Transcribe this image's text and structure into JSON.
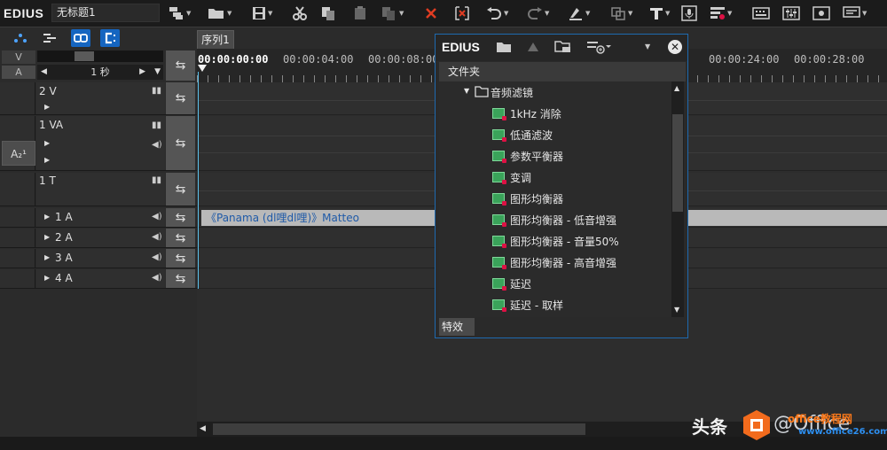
{
  "app": {
    "brand": "EDIUS",
    "project_name": "无标题1"
  },
  "toolbar": {
    "icons": [
      "new-sequence-icon",
      "open-folder-icon",
      "save-icon",
      "cut-icon",
      "copy-icon",
      "paste-icon",
      "paste-insert-icon",
      "delete-icon",
      "ripple-delete-icon",
      "undo-icon",
      "redo-icon",
      "set-in-out-icon",
      "layout-icon",
      "title-icon",
      "voice-over-icon",
      "render-icon",
      "keyboard-icon",
      "mixer-icon",
      "preview-icon",
      "settings-icon"
    ]
  },
  "mode_bar": {
    "sequence_tab": "序列1"
  },
  "track_header": {
    "v_label": "V",
    "a_label": "A",
    "scale": "1 秒",
    "a_channel": "A₂¹",
    "tracks": [
      {
        "name": "2 V",
        "type": "video"
      },
      {
        "name": "1 VA",
        "type": "video-audio"
      },
      {
        "name": "1 T",
        "type": "title"
      },
      {
        "name": "1 A",
        "type": "audio"
      },
      {
        "name": "2 A",
        "type": "audio"
      },
      {
        "name": "3 A",
        "type": "audio"
      },
      {
        "name": "4 A",
        "type": "audio"
      }
    ]
  },
  "ruler": {
    "timecodes": [
      "00:00:00:00",
      "00:00:04:00",
      "00:00:08:00",
      "00:00:24:00",
      "00:00:28:00"
    ]
  },
  "clip": {
    "label": "《Panama (dl哩dl哩)》Matteo"
  },
  "effects_panel": {
    "brand": "EDIUS",
    "folder_header": "文件夹",
    "folder_name": "音频滤镜",
    "items": [
      "1kHz 消除",
      "低通滤波",
      "参数平衡器",
      "变调",
      "图形均衡器",
      "图形均衡器 - 低音增强",
      "图形均衡器 - 音量50%",
      "图形均衡器 - 高音增强",
      "延迟",
      "延迟 - 取样"
    ],
    "tab": "特效"
  },
  "watermark": {
    "text1": "头条",
    "text2": "@Office",
    "site": "office教程网",
    "url": "www.office26.com"
  },
  "colors": {
    "accent": "#1565c0",
    "clip": "#b9b9b9",
    "clip_text": "#1f5aa8",
    "playline": "#5bc0eb"
  }
}
